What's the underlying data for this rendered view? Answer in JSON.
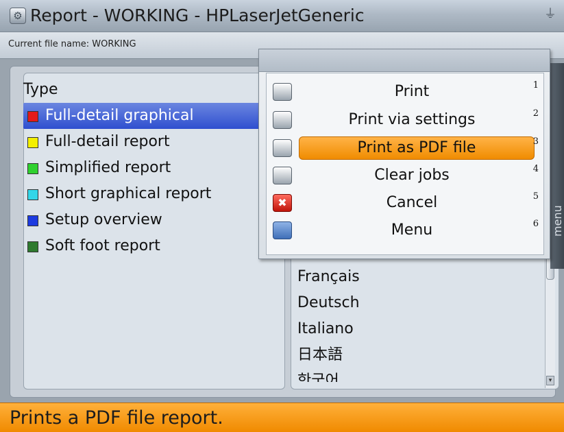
{
  "window": {
    "title": "Report - WORKING - HPLaserJetGeneric",
    "app_icon": "cog-icon",
    "right_icon": "plug-icon"
  },
  "file_bar": {
    "label": "Current file name: WORKING"
  },
  "type_panel": {
    "heading": "Type",
    "items": [
      {
        "label": "Full-detail graphical",
        "color": "#e31a1a",
        "selected": true
      },
      {
        "label": "Full-detail report",
        "color": "#f4f000",
        "selected": false
      },
      {
        "label": "Simplified report",
        "color": "#2fd12f",
        "selected": false
      },
      {
        "label": "Short graphical report",
        "color": "#33d6e8",
        "selected": false
      },
      {
        "label": "Setup overview",
        "color": "#1d3be0",
        "selected": false
      },
      {
        "label": "Soft foot report",
        "color": "#2f7a2f",
        "selected": false
      }
    ]
  },
  "language_panel": {
    "items": [
      "Français",
      "Deutsch",
      "Italiano",
      "日本語",
      "한국어"
    ]
  },
  "side_tab": {
    "label": "menu"
  },
  "popup_menu": {
    "items": [
      {
        "label": "Print",
        "shortcut": "1",
        "icon": "printer-icon"
      },
      {
        "label": "Print via settings",
        "shortcut": "2",
        "icon": "printer-settings-icon"
      },
      {
        "label": "Print as PDF file",
        "shortcut": "3",
        "icon": "printer-pdf-icon",
        "highlighted": true
      },
      {
        "label": "Clear jobs",
        "shortcut": "4",
        "icon": "printer-clear-icon"
      },
      {
        "label": "Cancel",
        "shortcut": "5",
        "icon": "cancel-icon"
      },
      {
        "label": "Menu",
        "shortcut": "6",
        "icon": "menu-icon"
      }
    ]
  },
  "status_bar": {
    "text": "Prints a PDF file report."
  }
}
